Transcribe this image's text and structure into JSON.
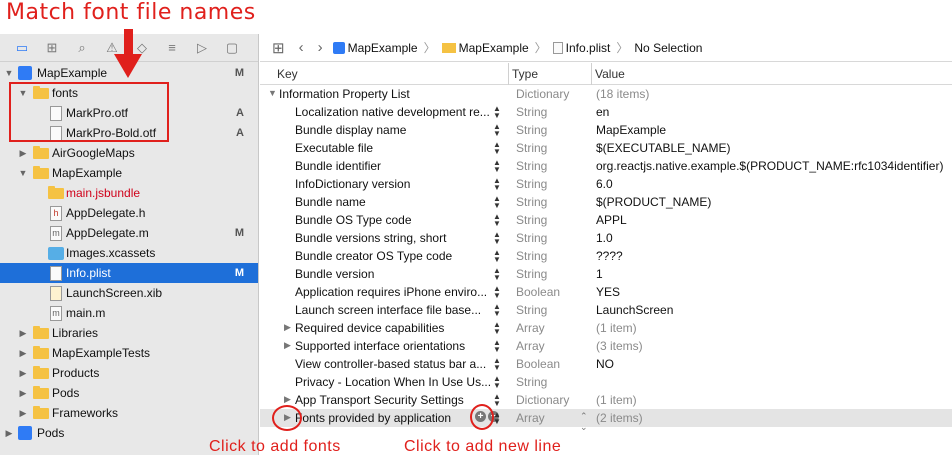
{
  "annotations": {
    "top": "Match font file names",
    "click_add_fonts": "Click to add fonts",
    "click_add_line": "Click to add new line"
  },
  "jumpbar": {
    "crumbs": [
      "MapExample",
      "MapExample",
      "Info.plist",
      "No Selection"
    ]
  },
  "navigator": {
    "items": [
      {
        "label": "MapExample",
        "badge": "M"
      },
      {
        "label": "fonts",
        "badge": ""
      },
      {
        "label": "MarkPro.otf",
        "badge": "A"
      },
      {
        "label": "MarkPro-Bold.otf",
        "badge": "A"
      },
      {
        "label": "AirGoogleMaps",
        "badge": ""
      },
      {
        "label": "MapExample",
        "badge": ""
      },
      {
        "label": "main.jsbundle",
        "badge": ""
      },
      {
        "label": "AppDelegate.h",
        "badge": ""
      },
      {
        "label": "AppDelegate.m",
        "badge": "M"
      },
      {
        "label": "Images.xcassets",
        "badge": ""
      },
      {
        "label": "Info.plist",
        "badge": "M"
      },
      {
        "label": "LaunchScreen.xib",
        "badge": ""
      },
      {
        "label": "main.m",
        "badge": ""
      },
      {
        "label": "Libraries",
        "badge": ""
      },
      {
        "label": "MapExampleTests",
        "badge": ""
      },
      {
        "label": "Products",
        "badge": ""
      },
      {
        "label": "Pods",
        "badge": ""
      },
      {
        "label": "Frameworks",
        "badge": ""
      },
      {
        "label": "Pods",
        "badge": ""
      }
    ]
  },
  "plist": {
    "headers": {
      "key": "Key",
      "type": "Type",
      "value": "Value"
    },
    "rows": [
      {
        "key": "Information Property List",
        "type": "Dictionary",
        "value": "(18 items)"
      },
      {
        "key": "Localization native development re...",
        "type": "String",
        "value": "en"
      },
      {
        "key": "Bundle display name",
        "type": "String",
        "value": "MapExample"
      },
      {
        "key": "Executable file",
        "type": "String",
        "value": "$(EXECUTABLE_NAME)"
      },
      {
        "key": "Bundle identifier",
        "type": "String",
        "value": "org.reactjs.native.example.$(PRODUCT_NAME:rfc1034identifier)"
      },
      {
        "key": "InfoDictionary version",
        "type": "String",
        "value": "6.0"
      },
      {
        "key": "Bundle name",
        "type": "String",
        "value": "$(PRODUCT_NAME)"
      },
      {
        "key": "Bundle OS Type code",
        "type": "String",
        "value": "APPL"
      },
      {
        "key": "Bundle versions string, short",
        "type": "String",
        "value": "1.0"
      },
      {
        "key": "Bundle creator OS Type code",
        "type": "String",
        "value": "????"
      },
      {
        "key": "Bundle version",
        "type": "String",
        "value": "1"
      },
      {
        "key": "Application requires iPhone enviro...",
        "type": "Boolean",
        "value": "YES"
      },
      {
        "key": "Launch screen interface file base...",
        "type": "String",
        "value": "LaunchScreen"
      },
      {
        "key": "Required device capabilities",
        "type": "Array",
        "value": "(1 item)"
      },
      {
        "key": "Supported interface orientations",
        "type": "Array",
        "value": "(3 items)"
      },
      {
        "key": "View controller-based status bar a...",
        "type": "Boolean",
        "value": "NO"
      },
      {
        "key": "Privacy - Location When In Use Us...",
        "type": "String",
        "value": ""
      },
      {
        "key": "App Transport Security Settings",
        "type": "Dictionary",
        "value": "(1 item)"
      },
      {
        "key": "Fonts provided by application",
        "type": "Array",
        "value": "(2 items)"
      }
    ]
  },
  "colors": {
    "accent": "#1e6fd9",
    "annotation": "#e0201c",
    "folder": "#f5c243"
  }
}
